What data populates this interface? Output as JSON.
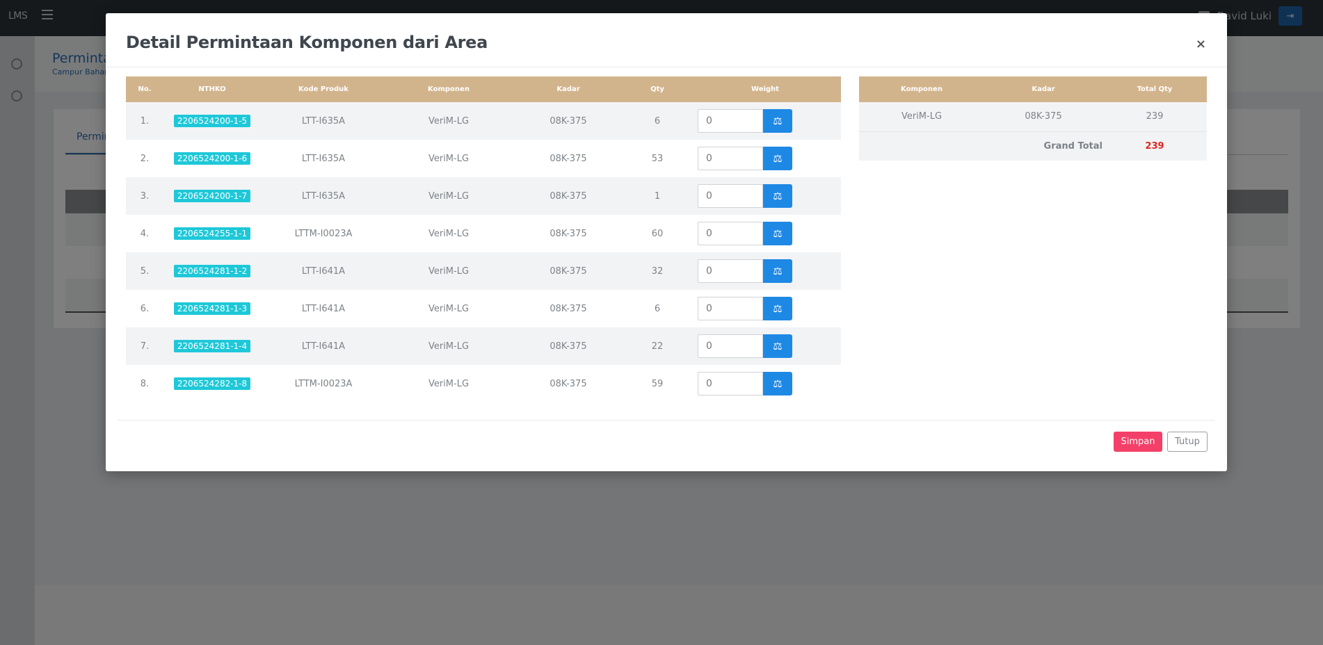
{
  "app": {
    "brand": "LMS",
    "user_name": "David Luki",
    "page_title": "Permintaan",
    "page_subtitle": "Campur Bahan",
    "bg_tab": "Permintaan"
  },
  "modal": {
    "title": "Detail Permintaan Komponen dari Area",
    "close_label": "×",
    "table": {
      "headers": [
        "No.",
        "NTHKO",
        "Kode Produk",
        "Komponen",
        "Kadar",
        "Qty",
        "Weight"
      ],
      "rows": [
        {
          "no": "1.",
          "nthko": "2206524200-1-5",
          "kode": "LTT-I635A",
          "komponen": "VeriM-LG",
          "kadar": "08K-375",
          "qty": "6",
          "weight": "0"
        },
        {
          "no": "2.",
          "nthko": "2206524200-1-6",
          "kode": "LTT-I635A",
          "komponen": "VeriM-LG",
          "kadar": "08K-375",
          "qty": "53",
          "weight": "0"
        },
        {
          "no": "3.",
          "nthko": "2206524200-1-7",
          "kode": "LTT-I635A",
          "komponen": "VeriM-LG",
          "kadar": "08K-375",
          "qty": "1",
          "weight": "0"
        },
        {
          "no": "4.",
          "nthko": "2206524255-1-1",
          "kode": "LTTM-I0023A",
          "komponen": "VeriM-LG",
          "kadar": "08K-375",
          "qty": "60",
          "weight": "0"
        },
        {
          "no": "5.",
          "nthko": "2206524281-1-2",
          "kode": "LTT-I641A",
          "komponen": "VeriM-LG",
          "kadar": "08K-375",
          "qty": "32",
          "weight": "0"
        },
        {
          "no": "6.",
          "nthko": "2206524281-1-3",
          "kode": "LTT-I641A",
          "komponen": "VeriM-LG",
          "kadar": "08K-375",
          "qty": "6",
          "weight": "0"
        },
        {
          "no": "7.",
          "nthko": "2206524281-1-4",
          "kode": "LTT-I641A",
          "komponen": "VeriM-LG",
          "kadar": "08K-375",
          "qty": "22",
          "weight": "0"
        },
        {
          "no": "8.",
          "nthko": "2206524282-1-8",
          "kode": "LTTM-I0023A",
          "komponen": "VeriM-LG",
          "kadar": "08K-375",
          "qty": "59",
          "weight": "0"
        }
      ]
    },
    "summary": {
      "headers": [
        "Komponen",
        "Kadar",
        "Total Qty"
      ],
      "row": {
        "komponen": "VeriM-LG",
        "kadar": "08K-375",
        "total_qty": "239"
      },
      "grand_label": "Grand Total",
      "grand_value": "239"
    },
    "buttons": {
      "save": "Simpan",
      "close": "Tutup"
    }
  },
  "colors": {
    "table_header": "#d2b48c",
    "badge": "#1ec8d8",
    "scale_button": "#1e88e5",
    "save_button": "#f43f68",
    "grand_total": "#e0241e"
  },
  "icons": {
    "weigh_button": "scale-icon"
  }
}
